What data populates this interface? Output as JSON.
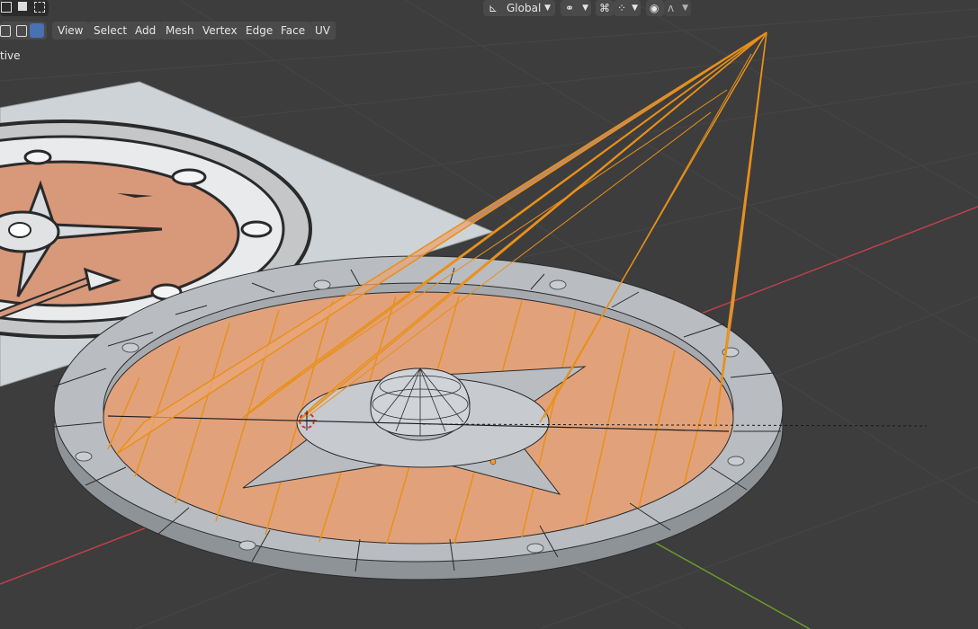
{
  "header": {
    "transform_orientation": "Global",
    "mode_label": "tive"
  },
  "menu": {
    "items": [
      {
        "label": "View"
      },
      {
        "label": "Select"
      },
      {
        "label": "Add"
      },
      {
        "label": "Mesh"
      },
      {
        "label": "Vertex"
      },
      {
        "label": "Edge"
      },
      {
        "label": "Face"
      },
      {
        "label": "UV"
      }
    ]
  },
  "colors": {
    "background": "#3d3d3d",
    "selected_face": "#e0a070",
    "selected_edge": "#e8901a",
    "mesh_wire": "#2a2a2a",
    "mesh_face": "#b8bcc2",
    "axis_x": "#c0404a",
    "axis_y": "#6a9a2a",
    "active_button": "#4772b3"
  },
  "icons": [
    "mode-select-icon",
    "mode-extend-icon",
    "mode-subtract-icon",
    "transform-orientation-icon",
    "pivot-icon",
    "snap-icon",
    "snap-target-icon",
    "proportional-edit-icon",
    "falloff-icon",
    "vertex-select-icon",
    "edge-select-icon",
    "face-select-icon"
  ]
}
